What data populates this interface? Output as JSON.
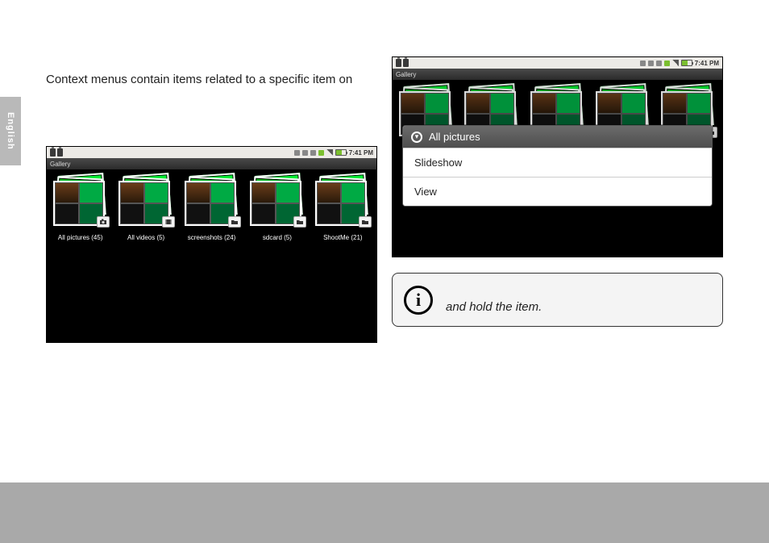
{
  "sideTab": "English",
  "bodyText": "Context menus contain items related to a specific item on",
  "status": {
    "time": "7:41 PM"
  },
  "appbar": {
    "title": "Gallery"
  },
  "albums": [
    {
      "name": "All pictures",
      "count": 45,
      "badge": "camera"
    },
    {
      "name": "All videos",
      "count": 5,
      "badge": "film"
    },
    {
      "name": "screenshots",
      "count": 24,
      "badge": "folder"
    },
    {
      "name": "sdcard",
      "count": 5,
      "badge": "folder"
    },
    {
      "name": "ShootMe",
      "count": 21,
      "badge": "folder"
    }
  ],
  "contextMenu": {
    "title": "All pictures",
    "items": [
      "Slideshow",
      "View"
    ]
  },
  "note": {
    "text": "and hold the item."
  }
}
